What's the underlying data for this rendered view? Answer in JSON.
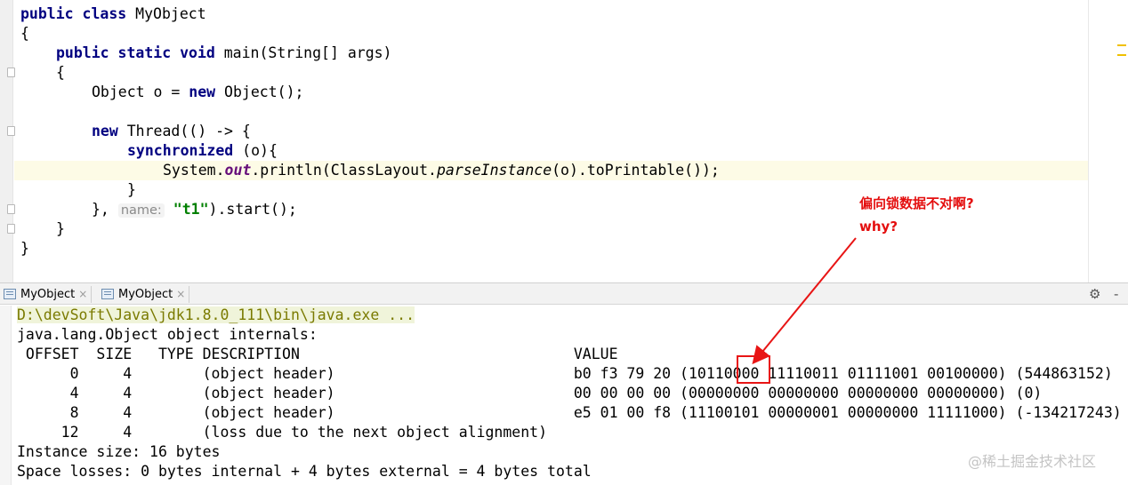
{
  "editor": {
    "lines": {
      "l1_kw": "public class",
      "l1_name": " MyObject",
      "l2": "{",
      "l3_kw": "public static void",
      "l3_rest": " main(String[] args)",
      "l4": "{",
      "l5_a": "Object o = ",
      "l5_kw": "new",
      "l5_b": " Object();",
      "l7_kw": "new",
      "l7_rest": " Thread(() -> {",
      "l8_kw": "synchronized",
      "l8_rest": " (o){",
      "l9_a": "System.",
      "l9_field": "out",
      "l9_b": ".println(ClassLayout.",
      "l9_ital": "parseInstance",
      "l9_c": "(o).toPrintable());",
      "l10": "}",
      "l11_a": "}, ",
      "l11_hint": "name:",
      "l11_str": "\"t1\"",
      "l11_b": ").start();",
      "l12": "}",
      "l13": "}"
    }
  },
  "run_tabs": [
    {
      "label": "MyObject",
      "close": "×"
    },
    {
      "label": "MyObject",
      "close": "×"
    }
  ],
  "toolbar": {
    "gear": "⚙",
    "minimize": "-"
  },
  "console": {
    "command": "D:\\devSoft\\Java\\jdk1.8.0_111\\bin\\java.exe ...",
    "internals_header": "java.lang.Object object internals:",
    "column_header": " OFFSET  SIZE   TYPE DESCRIPTION                               VALUE",
    "rows": [
      "      0     4        (object header)                           b0 f3 79 20 (10110000 11110011 01111001 00100000) (544863152)",
      "      4     4        (object header)                           00 00 00 00 (00000000 00000000 00000000 00000000) (0)",
      "      8     4        (object header)                           e5 01 00 f8 (11100101 00000001 00000000 11111000) (-134217243)",
      "     12     4        (loss due to the next object alignment)"
    ],
    "instance_size": "Instance size: 16 bytes",
    "space_losses": "Space losses: 0 bytes internal + 4 bytes external = 4 bytes total"
  },
  "annotation": {
    "line1": "偏向锁数据不对啊?",
    "line2": "why?",
    "color": "#e81515"
  },
  "watermark": "@稀土掘金技术社区"
}
